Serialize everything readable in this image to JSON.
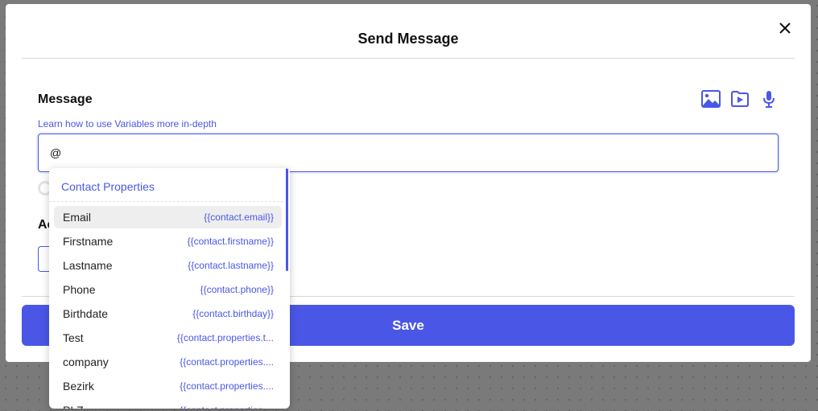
{
  "modal": {
    "title": "Send Message",
    "close_label": "×"
  },
  "message": {
    "label": "Message",
    "help_link": "Learn how to use Variables more in-depth",
    "input_value": "@",
    "media_icons": [
      "image-icon",
      "video-icon",
      "microphone-icon"
    ]
  },
  "section2": {
    "label_visible": "Ac"
  },
  "save": {
    "label": "Save"
  },
  "dropdown": {
    "header": "Contact Properties",
    "items": [
      {
        "name": "Email",
        "variable": "{{contact.email}}",
        "active": true
      },
      {
        "name": "Firstname",
        "variable": "{{contact.firstname}}"
      },
      {
        "name": "Lastname",
        "variable": "{{contact.lastname}}"
      },
      {
        "name": "Phone",
        "variable": "{{contact.phone}}"
      },
      {
        "name": "Birthdate",
        "variable": "{{contact.birthday}}"
      },
      {
        "name": "Test",
        "variable": "{{contact.properties.t..."
      },
      {
        "name": "company",
        "variable": "{{contact.properties...."
      },
      {
        "name": "Bezirk",
        "variable": "{{contact.properties...."
      },
      {
        "name": "PLZ",
        "variable": "{{contact.properties...."
      }
    ]
  },
  "colors": {
    "accent": "#4a57e6",
    "backdrop": "#7a7a7a"
  }
}
